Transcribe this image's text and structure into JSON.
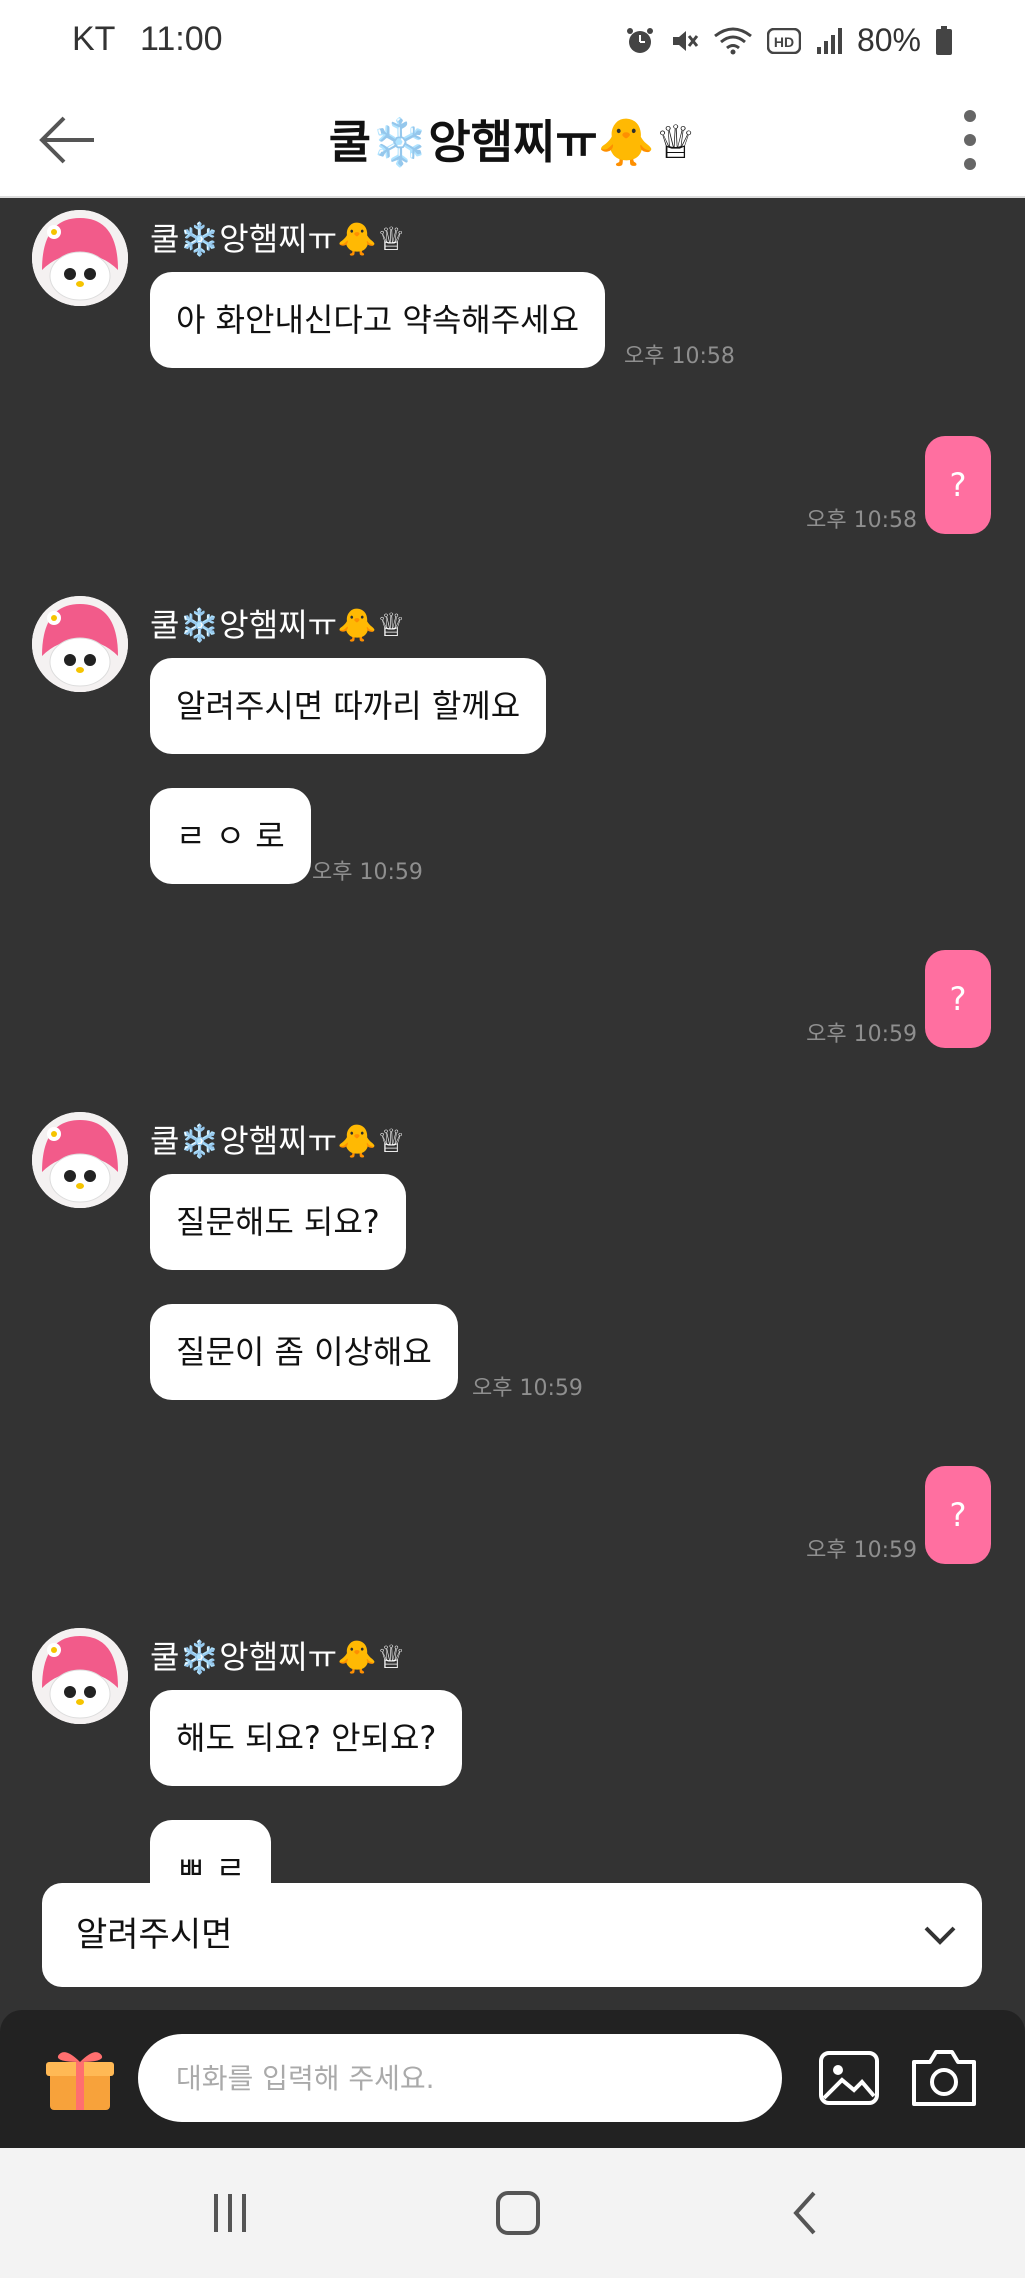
{
  "status_bar": {
    "carrier": "KT",
    "time": "11:00",
    "battery": "80%"
  },
  "header": {
    "title": "쿨❄️앙햄찌ㅠ🐥♕"
  },
  "messages": [
    {
      "side": "them",
      "sender": "쿨❄️앙햄찌ㅠ🐥♕",
      "bubbles": [
        "아 화안내신다고 약속해주세요"
      ],
      "time": "오후 10:58"
    },
    {
      "side": "me",
      "text": "?",
      "time": "오후 10:58"
    },
    {
      "side": "them",
      "sender": "쿨❄️앙햄찌ㅠ🐥♕",
      "bubbles": [
        "알려주시면 따까리 할께요",
        "ㄹ ㅇ 로"
      ],
      "time": "오후 10:59"
    },
    {
      "side": "me",
      "text": "?",
      "time": "오후 10:59"
    },
    {
      "side": "them",
      "sender": "쿨❄️앙햄찌ㅠ🐥♕",
      "bubbles": [
        "질문해도 되요?",
        "질문이 좀 이상해요"
      ],
      "time": "오후 10:59"
    },
    {
      "side": "me",
      "text": "?",
      "time": "오후 10:59"
    },
    {
      "side": "them",
      "sender": "쿨❄️앙햄찌ㅠ🐥♕",
      "bubbles": [
        "해도 되요? 안되요?",
        "ㅃ ㄹ"
      ]
    }
  ],
  "suggestion": {
    "text": "알려주시면"
  },
  "input": {
    "placeholder": "대화를 입력해 주세요."
  },
  "colors": {
    "background": "#333333",
    "my_bubble": "#ff6fa0",
    "their_bubble": "#ffffff",
    "timestamp": "#8f8f8f"
  },
  "icons": [
    "back-arrow-icon",
    "more-vert-icon",
    "gift-icon",
    "gallery-icon",
    "camera-icon",
    "chevron-down-icon",
    "alarm-icon",
    "mute-icon",
    "wifi-icon",
    "hd-icon",
    "signal-icon",
    "battery-icon",
    "recents-icon",
    "home-icon",
    "nav-back-icon"
  ]
}
